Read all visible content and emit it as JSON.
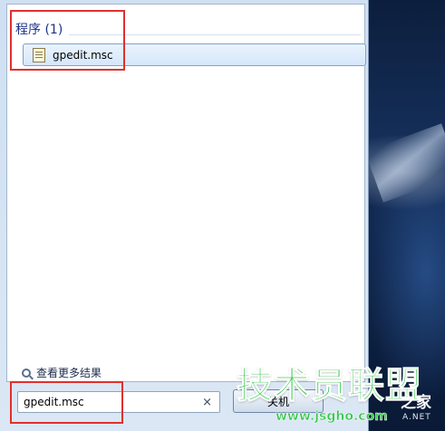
{
  "results": {
    "group_label": "程序 (1)",
    "items": [
      {
        "label": "gpedit.msc",
        "icon": "msc-file-icon"
      }
    ]
  },
  "see_more_label": "查看更多结果",
  "search": {
    "value": "gpedit.msc",
    "clear_glyph": "×"
  },
  "shutdown_label": "关机",
  "watermark": {
    "brand": "技术员联盟",
    "suffix": "之家",
    "url": "www.jsgho.com",
    "domain_tail": "A.NET"
  },
  "colors": {
    "annotation": "#e0302e",
    "watermark": "#35c64b",
    "group_header": "#1e3287"
  }
}
